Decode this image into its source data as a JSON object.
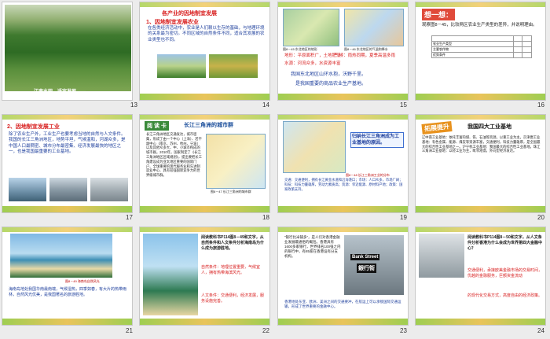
{
  "slides": [
    {
      "num": "13",
      "caption": "江南水田，适宜发展——"
    },
    {
      "num": "14",
      "title": "各产业的因地制宜发展",
      "heading": "1、因地制宜发展农业",
      "body": "在各类经济活动中，农业是人们赖以生存的基础，与地理环境的关系最为密切。不同区域的自然条件不同，适合其发展的农业类型也不同。"
    },
    {
      "num": "15",
      "map1": "图8－45 东北地区的地形",
      "map2": "图8－46 东北地区的气温和降水",
      "l1": "地形：平原面积广，土地肥沃",
      "l2": "气候：雨热同期，夏季高温多雨",
      "l3": "水源：河流众多，水资源丰富",
      "l4": "我国东北地区山环水抱，沃野千里。",
      "l5": "是我国重要的商品农业生产基地。"
    },
    {
      "num": "16",
      "title": "想一想：",
      "q": "观察图8－45，比较两区农业生产类型的差异，并说明理由。",
      "tbl": [
        "农业生产类型",
        "主要农作物",
        "优势条件"
      ]
    },
    {
      "num": "17",
      "heading": "2、因地制宜发展工业",
      "body": "除了农业生产外，工业生产也要考虑当地的自然与人文条件。我国的长江三角洲地区，地势平坦，气候温和，河湖众多，是中国人口最稠密、城市分布最密集、经济发展最快的地区之一，也是我国最重要的工业基地。"
    },
    {
      "num": "18",
      "badge": "阅 读 卡",
      "title": "长江三角洲的城市群",
      "body": "长江三角洲地区交通发达，城市密集，形成了由一个中心（上海）、若干副中心（南京、苏州、杭州、宁波）以及其他众多大、中、小城市构成的城市群。2010年，国家制定了《长江三角洲地区区域规划》，提出要把长三角建设成为亚太地区重要的国际门户、全球重要的现代服务业和先进制造业中心、具有较强国际竞争力的世界级城市群。",
      "map": "图8－47 长江三角洲的城市群"
    },
    {
      "num": "19",
      "box": "归纳长江三角洲成为工业基地的原因。",
      "map": "图8－48 长江三角洲工业的分布",
      "body": "交通：交通便利，拥有长江黄金水道和沿海港口；市场：人口众多，市场广阔；科技：科技力量雄厚，劳动力素质高；资源：邻近能源、原材料产地；政策：国家政策支持。"
    },
    {
      "num": "20",
      "badge": "拓展提升",
      "title": "我国四大工业基地",
      "body": "辽中南工业基地：依托丰富的煤、铁、石油等资源，以重工业为主。京津唐工业基地：有色金属、能源、煤炭等资源丰富，交通便利，科技力量雄厚，是全国最大的综合性工业基地之一。沪宁杭工业基地：我国最大的综合性工业基地。珠江三角洲工业基地：以轻工业为主，毗邻港澳，外向型经济发达。"
    },
    {
      "num": "21",
      "map": "图8－49 海南岛自然风光",
      "body": "海南岛地处我国华南最南端，气候湿热，四季如春，有大片的热带雨林，自然风光优美，是我国著名的旅游胜地。"
    },
    {
      "num": "22",
      "body": "阅读教科书P114图8－49和文字，从自然条件和人文条件分析海南岛为什么成为旅游胜地。",
      "n1": "自然条件：地理位置重要，气候宜人，拥有热带海滨风光。",
      "n2": "人文条件：交通便利，经济发展，服务设施完善。"
    },
    {
      "num": "23",
      "body": "“银行比米铺多”，是人们对香港金融业发展最通俗的概括。香港具有1600多家银行，世界排名100强之内的银行中，有85家在香港设有分支机构。",
      "sign1": "Bank Street",
      "sign2": "銀行街",
      "bottom": "香港地处东亚、欧洲、美洲之间的交通要冲，在航运上可以承接国际交通运输，形成了世界重要的金融中心。"
    },
    {
      "num": "24",
      "body": "阅读教科书P114图8－50和文字，从人文条件分析香港为什么会成为世界第四大金融中心？",
      "n1": "交通便利，承接欧美金融市场的交易时间，优越的金融服务，巨额资金流动",
      "n2": "的现代化交易方式，高度自由的经济政策。"
    }
  ]
}
